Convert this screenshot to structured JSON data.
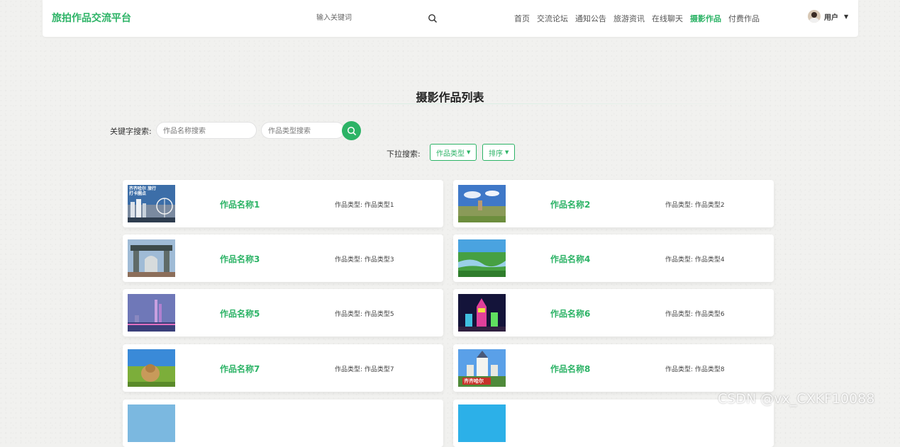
{
  "header": {
    "logo": "旅拍作品交流平台",
    "search_placeholder": "输入关键词",
    "nav": [
      "首页",
      "交流论坛",
      "通知公告",
      "旅游资讯",
      "在线聊天",
      "摄影作品",
      "付费作品"
    ],
    "active_nav_index": 5,
    "user_name": "用户"
  },
  "page": {
    "title": "摄影作品列表",
    "keyword_label": "关键字搜索:",
    "name_placeholder": "作品名称搜索",
    "type_placeholder": "作品类型搜索",
    "dropdown_label": "下拉搜索:",
    "dropdown_type": "作品类型",
    "dropdown_sort": "排序"
  },
  "type_label": "作品类型:",
  "cards": [
    {
      "name": "作品名称1",
      "type": "作品类型1",
      "overlay": "齐齐哈尔 旅行打卡圈点"
    },
    {
      "name": "作品名称2",
      "type": "作品类型2"
    },
    {
      "name": "作品名称3",
      "type": "作品类型3"
    },
    {
      "name": "作品名称4",
      "type": "作品类型4"
    },
    {
      "name": "作品名称5",
      "type": "作品类型5"
    },
    {
      "name": "作品名称6",
      "type": "作品类型6"
    },
    {
      "name": "作品名称7",
      "type": "作品类型7"
    },
    {
      "name": "作品名称8",
      "type": "作品类型8",
      "overlay": "齐齐哈尔"
    }
  ],
  "colors": {
    "accent": "#2cb366"
  },
  "watermark": "CSDN @vx_CXKF10088"
}
